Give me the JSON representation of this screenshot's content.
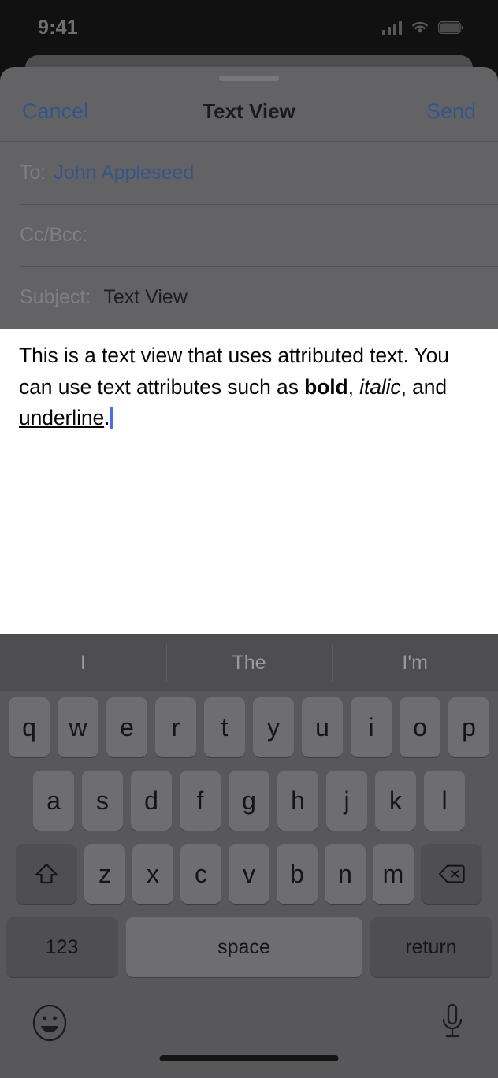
{
  "status_bar": {
    "time": "9:41",
    "cellular_icon": "cellular-signal-icon",
    "wifi_icon": "wifi-icon",
    "battery_icon": "battery-icon"
  },
  "sheet": {
    "grabber": "sheet-grabber-handle"
  },
  "navbar": {
    "cancel_label": "Cancel",
    "title": "Text View",
    "send_label": "Send",
    "accent_color": "#34558b"
  },
  "compose": {
    "fields": [
      {
        "label": "To:",
        "value": "John Appleseed",
        "is_recipient": true
      },
      {
        "label": "Cc/Bcc:",
        "value": "",
        "is_recipient": false
      },
      {
        "label": "Subject:",
        "value": "Text View",
        "is_recipient": false
      }
    ]
  },
  "body": {
    "segment_1": "This is a text view that uses attributed text. You can use text attributes such as ",
    "segment_bold": "bold",
    "segment_2": ", ",
    "segment_italic": "italic",
    "segment_3": ", and ",
    "segment_underline": "underline",
    "segment_4": ".",
    "caret_color": "#4a6cf0",
    "full_text": "This is a text view that uses attributed text. You can use text attributes such as bold, italic, and underline."
  },
  "keyboard": {
    "suggestions": [
      "I",
      "The",
      "I'm"
    ],
    "row1": [
      "q",
      "w",
      "e",
      "r",
      "t",
      "y",
      "u",
      "i",
      "o",
      "p"
    ],
    "row2": [
      "a",
      "s",
      "d",
      "f",
      "g",
      "h",
      "j",
      "k",
      "l"
    ],
    "row3": [
      "z",
      "x",
      "c",
      "v",
      "b",
      "n",
      "m"
    ],
    "shift_icon": "shift-arrow-icon",
    "delete_icon": "delete-backspace-icon",
    "numbers_label": "123",
    "space_label": "space",
    "return_label": "return",
    "emoji_icon": "emoji-smiley-icon",
    "mic_icon": "microphone-icon"
  },
  "home_indicator": "home-indicator-bar"
}
